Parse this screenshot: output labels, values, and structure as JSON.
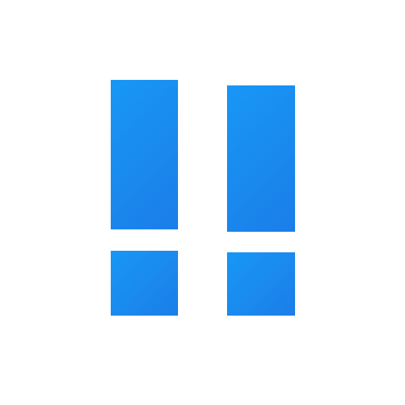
{
  "icon": {
    "name": "double-exclamation-icon",
    "colors": {
      "background": "#ffffff",
      "gradient_start": "#1897f6",
      "gradient_end": "#1b7ee8"
    }
  }
}
